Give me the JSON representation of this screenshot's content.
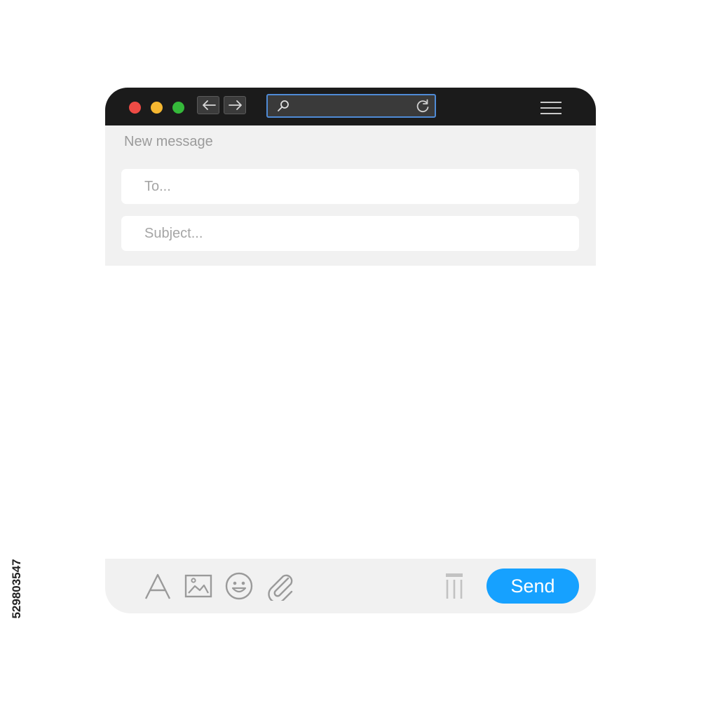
{
  "browser": {
    "traffic_lights": {
      "close": "#ee4b45",
      "minimize": "#f5b731",
      "zoom": "#35b93a"
    },
    "icons": [
      "back-arrow-icon",
      "forward-arrow-icon",
      "search-icon",
      "reload-icon",
      "menu-icon"
    ],
    "url_value": ""
  },
  "compose": {
    "title": "New message",
    "to_placeholder": "To...",
    "subject_placeholder": "Subject..."
  },
  "toolbar": {
    "icons": [
      "text-format-icon",
      "image-icon",
      "emoji-icon",
      "attachment-icon",
      "trash-icon"
    ],
    "send_label": "Send",
    "accent": "#16a1ff"
  },
  "watermark_id": "529803547"
}
